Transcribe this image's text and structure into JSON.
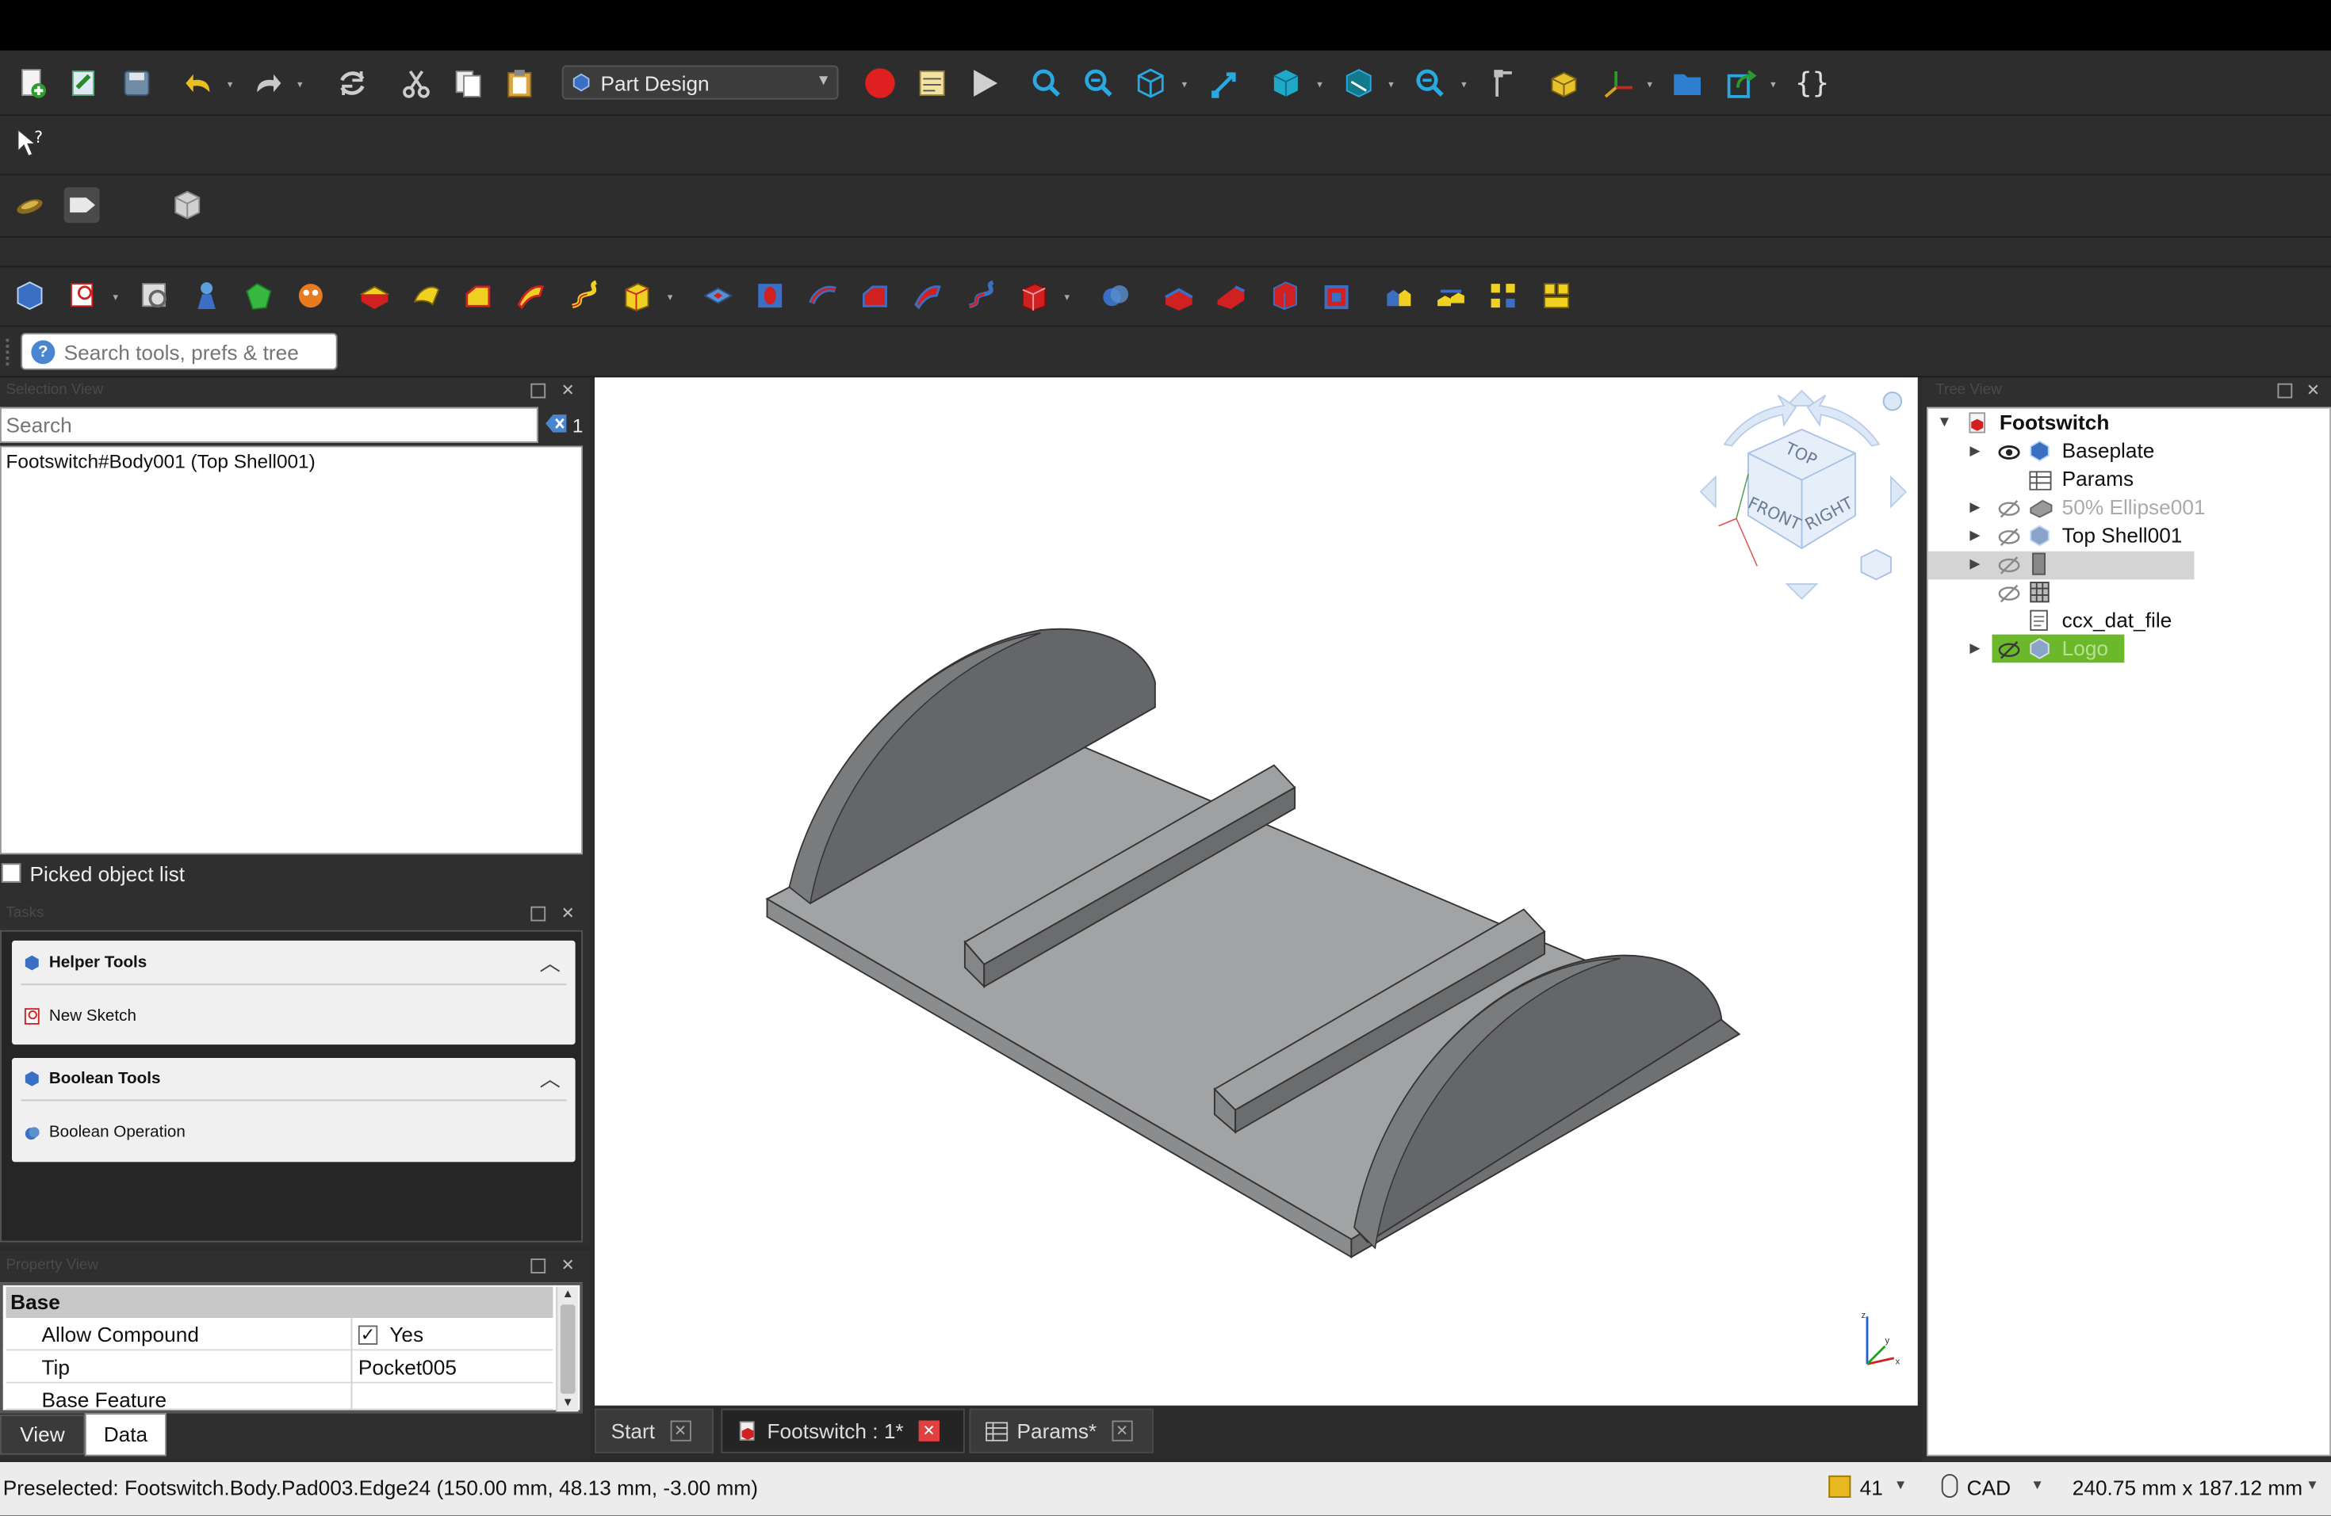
{
  "toolbar": {
    "workbench": "Part Design",
    "search_placeholder": "Search tools, prefs & tree"
  },
  "selection_view": {
    "title": "Selection View",
    "search_placeholder": "Search",
    "count": "1",
    "items": [
      "Footswitch#Body001 (Top Shell001)"
    ],
    "picked_label": "Picked object list"
  },
  "tasks": {
    "title": "Tasks",
    "helper_title": "Helper Tools",
    "helper_items": [
      "New Sketch"
    ],
    "boolean_title": "Boolean Tools",
    "boolean_items": [
      "Boolean Operation"
    ]
  },
  "property_view": {
    "title": "Property View",
    "group": "Base",
    "rows": [
      {
        "name": "Allow Compound",
        "value": "Yes"
      },
      {
        "name": "Tip",
        "value": "Pocket005"
      },
      {
        "name": "Base Feature",
        "value": ""
      }
    ],
    "tabs": [
      "View",
      "Data"
    ]
  },
  "tree_view": {
    "title": "Tree View",
    "root": "Footswitch",
    "items": [
      {
        "label": "Baseplate"
      },
      {
        "label": "Params"
      },
      {
        "label": "50% Ellipse001"
      },
      {
        "label": "Top Shell001"
      },
      {
        "label": ""
      },
      {
        "label": ""
      },
      {
        "label": "ccx_dat_file"
      },
      {
        "label": "Logo"
      }
    ]
  },
  "navcube": {
    "top": "TOP",
    "front": "FRONT",
    "right": "RIGHT"
  },
  "doc_tabs": [
    "Start",
    "Footswitch : 1*",
    "Params*"
  ],
  "status": {
    "preselected": "Preselected: Footswitch.Body.Pad003.Edge24 (150.00 mm, 48.13 mm, -3.00 mm)",
    "count": "41",
    "nav_style": "CAD",
    "dimensions": "240.75 mm x 187.12 mm"
  },
  "colors": {
    "accent_green": "#6bb82a",
    "record_red": "#e02020"
  }
}
